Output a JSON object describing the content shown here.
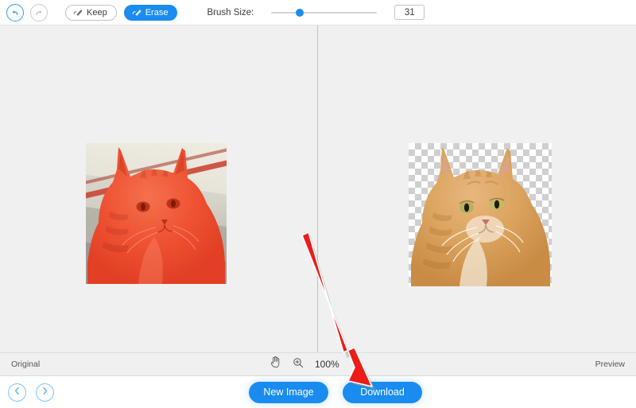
{
  "toolbar": {
    "undo": {
      "name": "Undo",
      "state": "enabled"
    },
    "redo": {
      "name": "Redo",
      "state": "disabled"
    },
    "keep_label": "Keep",
    "erase_label": "Erase",
    "active_mode": "Erase",
    "brush_size_label": "Brush Size:",
    "brush_size_value": "31",
    "brush_slider_percent": 27
  },
  "canvas": {
    "original_pane": {
      "label": "Original",
      "description": "Orange tabby cat photo with red erase-mask overlay on the subject"
    },
    "preview_pane": {
      "label": "Preview",
      "description": "Orange tabby cat cut out on transparent checkerboard background"
    }
  },
  "statusbar": {
    "original_label": "Original",
    "preview_label": "Preview",
    "pan_tool": "hand-tool",
    "zoom_tool": "zoom-in-tool",
    "zoom_level": "100%"
  },
  "bottombar": {
    "prev_label": "Previous",
    "next_label": "Next",
    "new_image_label": "New Image",
    "download_label": "Download"
  },
  "annotation": {
    "arrow_color": "#ec1c16",
    "points_to": "Download"
  },
  "colors": {
    "accent": "#1a8cf0",
    "canvas_bg": "#f0f0f0",
    "mask_red": "#ef4a2e",
    "arrow_red": "#ec1c16"
  }
}
